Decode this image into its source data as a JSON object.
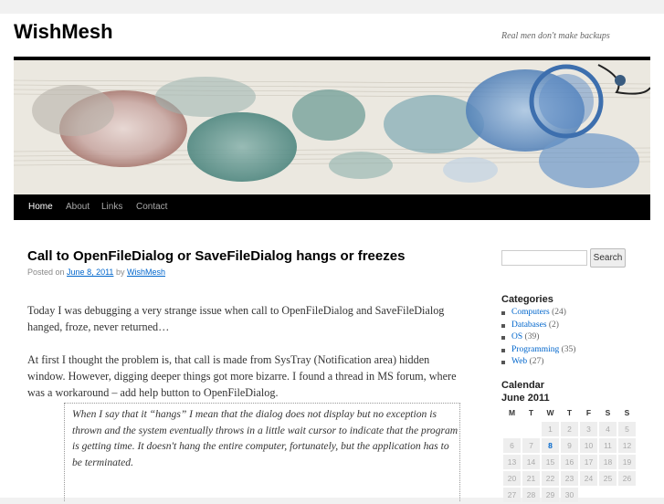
{
  "site": {
    "title": "WishMesh",
    "tagline": "Real men don't make backups"
  },
  "nav": {
    "items": [
      "Home",
      "About",
      "Links",
      "Contact"
    ]
  },
  "post": {
    "title": "Call to OpenFileDialog or SaveFileDialog hangs or freezes",
    "meta_prefix": "Posted on",
    "date": "June 8, 2011",
    "meta_by": "by",
    "author": "WishMesh",
    "paragraphs": [
      "Today I was debugging a very strange issue when call to OpenFileDialog and SaveFileDialog hanged, froze, never returned…",
      "At first I thought the problem is, that call is made from SysTray (Notification area) hidden window. However, digging deeper things got more bizarre. I found a thread in MS forum, where was a workaround – add help button to OpenFileDialog."
    ],
    "quote": "When I say that it “hangs” I mean that the dialog does not display but no exception is thrown and the system eventually throws in a little wait cursor to indicate that the program is getting time. It doesn't hang the entire computer, fortunately, but the application has to be terminated."
  },
  "sidebar": {
    "search_button": "Search",
    "search_value": "",
    "categories_title": "Categories",
    "categories": [
      {
        "name": "Computers",
        "count": "(24)"
      },
      {
        "name": "Databases",
        "count": "(2)"
      },
      {
        "name": "OS",
        "count": "(39)"
      },
      {
        "name": "Programming",
        "count": "(35)"
      },
      {
        "name": "Web",
        "count": "(27)"
      }
    ],
    "calendar_title": "Calendar",
    "calendar_month": "June 2011",
    "calendar_days": [
      "M",
      "T",
      "W",
      "T",
      "F",
      "S",
      "S"
    ],
    "calendar_weeks": [
      [
        "",
        "",
        "1",
        "2",
        "3",
        "4",
        "5"
      ],
      [
        "6",
        "7",
        "8",
        "9",
        "10",
        "11",
        "12"
      ],
      [
        "13",
        "14",
        "15",
        "16",
        "17",
        "18",
        "19"
      ],
      [
        "20",
        "21",
        "22",
        "23",
        "24",
        "25",
        "26"
      ],
      [
        "27",
        "28",
        "29",
        "30",
        "",
        "",
        ""
      ]
    ],
    "calendar_linked_day": "8"
  },
  "colors": {
    "link": "#0066cc",
    "nav_bg": "#000000"
  }
}
